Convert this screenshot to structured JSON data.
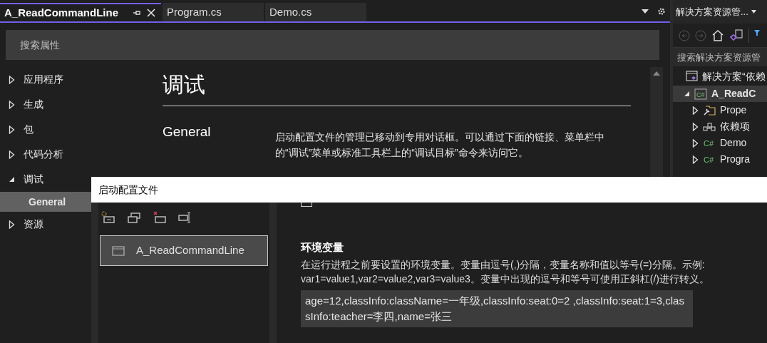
{
  "tabs": [
    {
      "label": "A_ReadCommandLine",
      "selected": true
    },
    {
      "label": "Program.cs",
      "selected": false
    },
    {
      "label": "Demo.cs",
      "selected": false
    }
  ],
  "search": {
    "placeholder": "搜索属性"
  },
  "nav": [
    {
      "label": "应用程序",
      "expanded": false,
      "selected": false
    },
    {
      "label": "生成",
      "expanded": false,
      "selected": false
    },
    {
      "label": "包",
      "expanded": false,
      "selected": false
    },
    {
      "label": "代码分析",
      "expanded": false,
      "selected": false
    },
    {
      "label": "调试",
      "expanded": true,
      "selected": false,
      "children": [
        {
          "label": "General",
          "selected": true
        }
      ]
    },
    {
      "label": "资源",
      "expanded": false,
      "selected": false
    }
  ],
  "page": {
    "title": "调试",
    "section": "General",
    "description": "启动配置文件的管理已移动到专用对话框。可以通过下面的链接、菜单栏中的“调试”菜单或标准工具栏上的“调试目标”命令来访问它。"
  },
  "dialog": {
    "title": "启动配置文件",
    "profiles": [
      {
        "label": "A_ReadCommandLine",
        "selected": true
      }
    ],
    "checkbox": {
      "checked": false
    },
    "env": {
      "heading": "环境变量",
      "description": "在运行进程之前要设置的环境变量。变量由逗号(,)分隔，变量名称和值以等号(=)分隔。示例: var1=value1,var2=value2,var3=value3。变量中出现的逗号和等号可使用正斜杠(/)进行转义。",
      "value": "age=12,classInfo:className=一年级,classInfo:seat:0=2 ,classInfo:seat:1=3,classInfo:teacher=李四,name=张三"
    }
  },
  "solution_explorer": {
    "title": "解决方案资源管...",
    "search": {
      "placeholder": "搜索解决方案资源管"
    },
    "tree": [
      {
        "label": "解决方案“依赖",
        "kind": "solution",
        "selected": false,
        "children": [
          {
            "label": "A_ReadC",
            "kind": "project",
            "icon_label": "C#",
            "expanded": true,
            "selected": true,
            "children": [
              {
                "label": "Prope",
                "kind": "properties",
                "expanded": false,
                "selected": false
              },
              {
                "label": "依赖项",
                "kind": "dependencies",
                "expanded": false,
                "selected": false
              },
              {
                "label": "Demo",
                "kind": "csharp",
                "icon_label": "C#",
                "expanded": false,
                "selected": false
              },
              {
                "label": "Progra",
                "kind": "csharp",
                "icon_label": "C#",
                "expanded": false,
                "selected": false
              }
            ]
          }
        ]
      }
    ]
  }
}
